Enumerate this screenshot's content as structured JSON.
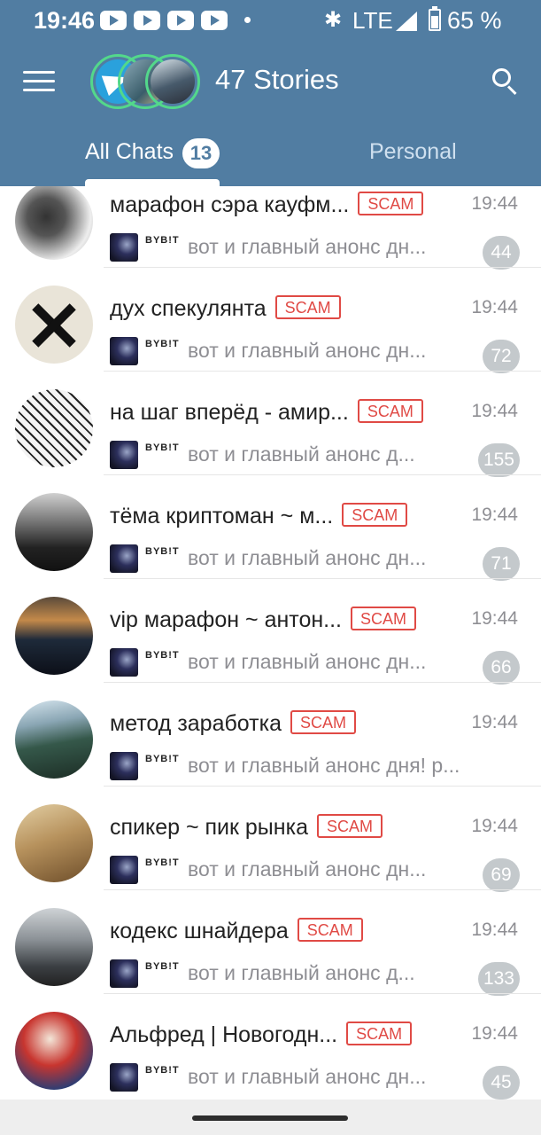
{
  "status_bar": {
    "time": "19:46",
    "network": "LTE",
    "battery": "65 %",
    "icons": [
      "youtube-icon",
      "youtube-icon",
      "youtube-icon",
      "youtube-icon",
      "dot",
      "bluetooth-icon",
      "signal-icon",
      "battery-icon"
    ]
  },
  "header": {
    "stories_title": "47 Stories",
    "menu_icon": "hamburger-menu-icon",
    "search_icon": "search-icon"
  },
  "tabs": {
    "all_chats": "All Chats",
    "all_chats_count": "13",
    "personal": "Personal"
  },
  "colors": {
    "header": "#517da2",
    "scam_label": "#e04a45",
    "unread_badge": "#c4c9cc",
    "story_ring": "#53d88b"
  },
  "chats": [
    {
      "name": "марафон сэра кауфм...",
      "tag": "SCAM",
      "time": "19:44",
      "sender": "BYB!T",
      "preview": "вот и главный анонс дн...",
      "unread": "44"
    },
    {
      "name": "дух спекулянта",
      "tag": "SCAM",
      "time": "19:44",
      "sender": "BYB!T",
      "preview": "вот и главный анонс дн...",
      "unread": "72"
    },
    {
      "name": "на шаг вперёд - амир...",
      "tag": "SCAM",
      "time": "19:44",
      "sender": "BYB!T",
      "preview": "вот и главный анонс д...",
      "unread": "155"
    },
    {
      "name": "тёма криптоман ~ м...",
      "tag": "SCAM",
      "time": "19:44",
      "sender": "BYB!T",
      "preview": "вот и главный анонс дн...",
      "unread": "71"
    },
    {
      "name": "vip марафон ~ антон...",
      "tag": "SCAM",
      "time": "19:44",
      "sender": "BYB!T",
      "preview": "вот и главный анонс дн...",
      "unread": "66"
    },
    {
      "name": "метод заработка",
      "tag": "SCAM",
      "time": "19:44",
      "sender": "BYB!T",
      "preview": "вот и главный анонс дня!   р...",
      "unread": ""
    },
    {
      "name": "спикер ~ пик рынка",
      "tag": "SCAM",
      "time": "19:44",
      "sender": "BYB!T",
      "preview": "вот и главный анонс дн...",
      "unread": "69"
    },
    {
      "name": "кодекс шнайдера",
      "tag": "SCAM",
      "time": "19:44",
      "sender": "BYB!T",
      "preview": "вот и главный анонс д...",
      "unread": "133"
    },
    {
      "name": "Альфред | Новогодн...",
      "tag": "SCAM",
      "time": "19:44",
      "sender": "BYB!T",
      "preview": "вот и главный анонс дн...",
      "unread": "45"
    }
  ]
}
